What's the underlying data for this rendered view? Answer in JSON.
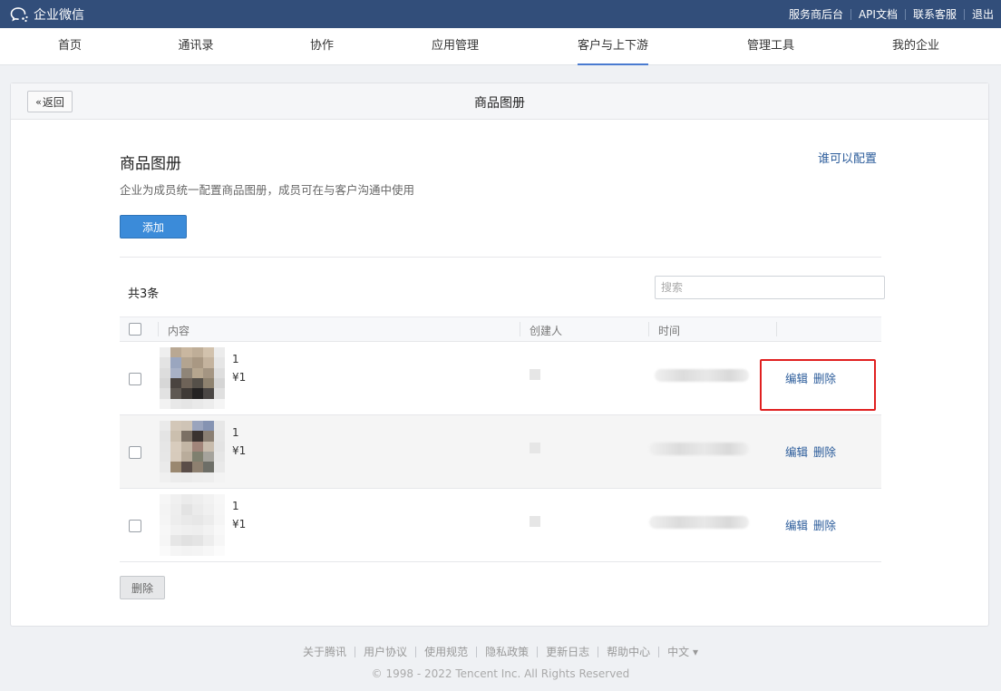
{
  "topbar": {
    "logo_text": "企业微信",
    "links": [
      "服务商后台",
      "API文档",
      "联系客服",
      "退出"
    ]
  },
  "nav": {
    "items": [
      "首页",
      "通讯录",
      "协作",
      "应用管理",
      "客户与上下游",
      "管理工具",
      "我的企业"
    ],
    "active": "客户与上下游"
  },
  "card": {
    "back_label": "返回",
    "title": "商品图册"
  },
  "page": {
    "heading": "商品图册",
    "who_can_config": "谁可以配置",
    "description": "企业为成员统一配置商品图册，成员可在与客户沟通中使用",
    "add_label": "添加",
    "count_text": "共3条",
    "search_placeholder": "搜索"
  },
  "table": {
    "headers": [
      "内容",
      "创建人",
      "时间"
    ],
    "rows": [
      {
        "name": "1",
        "price": "¥1",
        "edit": "编辑",
        "delete": "删除"
      },
      {
        "name": "1",
        "price": "¥1",
        "edit": "编辑",
        "delete": "删除"
      },
      {
        "name": "1",
        "price": "¥1",
        "edit": "编辑",
        "delete": "删除"
      }
    ],
    "delete_button": "删除"
  },
  "footer": {
    "links": [
      "关于腾讯",
      "用户协议",
      "使用规范",
      "隐私政策",
      "更新日志",
      "帮助中心",
      "中文 ▾"
    ],
    "copyright": "© 1998 - 2022 Tencent Inc. All Rights Reserved"
  },
  "colors": {
    "topbar": "#324e7a",
    "primary": "#3b8bd9",
    "link": "#2a5b9a",
    "highlight": "#e02020"
  }
}
